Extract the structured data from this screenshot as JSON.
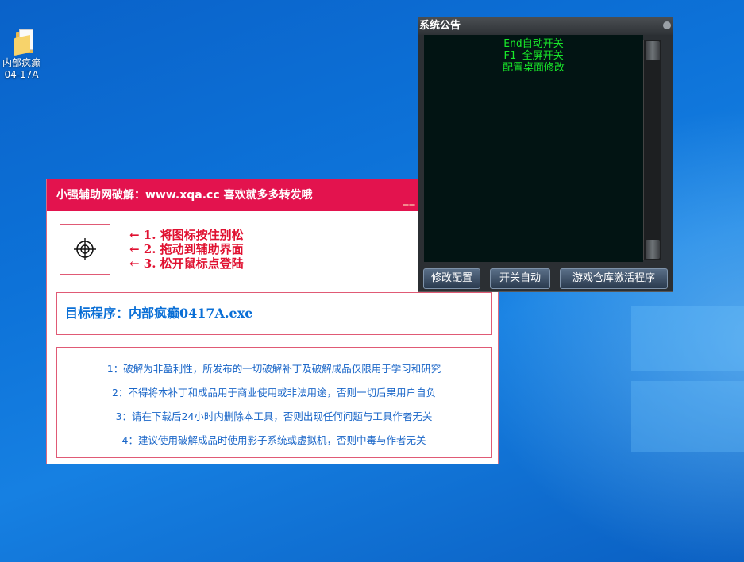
{
  "desktop": {
    "icon": {
      "label_line1": "内部疯癫",
      "label_line2": "04-17A"
    }
  },
  "tool": {
    "title": "小强辅助网破解：www.xqa.cc   喜欢就多多转发哦",
    "title_mini": "——",
    "steps": [
      "←  1. 将图标按住别松",
      "←  2. 拖动到辅助界面",
      "←  3. 松开鼠标点登陆"
    ],
    "target": "目标程序：内部疯癫0417A.exe",
    "notices": [
      "1：破解为非盈利性，所发布的一切破解补丁及破解成品仅限用于学习和研究",
      "2：不得将本补丁和成品用于商业使用或非法用途，否则一切后果用户自负",
      "3：请在下载后24小时内删除本工具，否则出现任何问题与工具作者无关",
      "4：建议使用破解成品时使用影子系统或虚拟机，否则中毒与作者无关"
    ]
  },
  "announcement": {
    "title": "系统公告",
    "lines": [
      "End自动开关",
      "F1 全屏开关",
      "配置桌面修改"
    ],
    "buttons": [
      "修改配置",
      "开关自动",
      "游戏仓库激活程序"
    ],
    "text_color": "#19e82a"
  },
  "colors": {
    "brand": "#e3134e",
    "link": "#1a66c8",
    "step": "#e01030"
  }
}
